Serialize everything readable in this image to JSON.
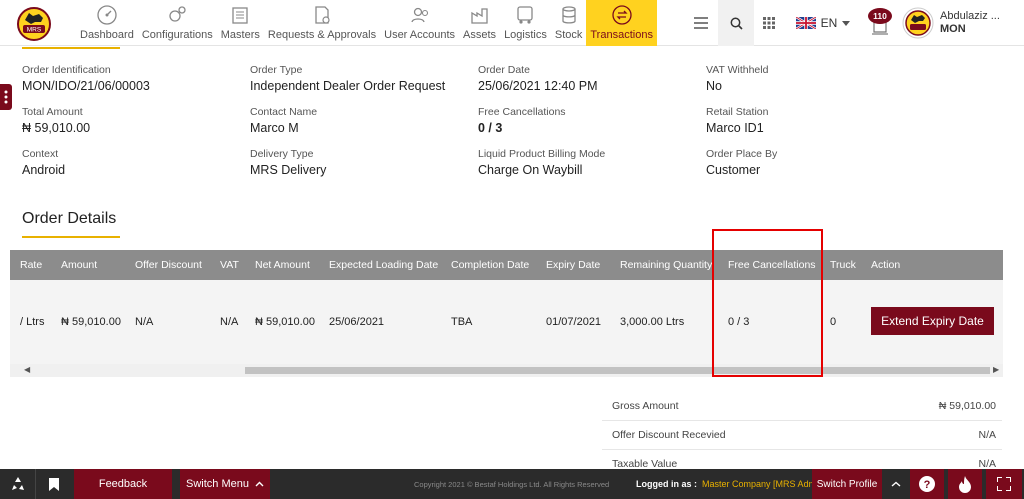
{
  "nav": {
    "items": [
      {
        "label": "Dashboard",
        "icon": "dashboard-icon"
      },
      {
        "label": "Configurations",
        "icon": "configurations-icon"
      },
      {
        "label": "Masters",
        "icon": "masters-icon"
      },
      {
        "label": "Requests & Approvals",
        "icon": "requests-icon"
      },
      {
        "label": "User Accounts",
        "icon": "user-accounts-icon"
      },
      {
        "label": "Assets",
        "icon": "assets-icon"
      },
      {
        "label": "Logistics",
        "icon": "logistics-icon"
      },
      {
        "label": "Stock",
        "icon": "stock-icon"
      },
      {
        "label": "Transactions",
        "icon": "transactions-icon",
        "active": true
      }
    ],
    "lang": "EN",
    "notifications": "110",
    "user_name": "Abdulaziz ...",
    "user_sub": "MON",
    "logo_text": "MRS"
  },
  "order": {
    "rows": [
      [
        {
          "label": "Order Identification",
          "value": "MON/IDO/21/06/00003"
        },
        {
          "label": "Order Type",
          "value": "Independent Dealer Order Request"
        },
        {
          "label": "Order Date",
          "value": "25/06/2021 12:40 PM"
        },
        {
          "label": "VAT Withheld",
          "value": "No"
        }
      ],
      [
        {
          "label": "Total Amount",
          "value": "₦ 59,010.00"
        },
        {
          "label": "Contact Name",
          "value": "Marco M"
        },
        {
          "label": "Free Cancellations",
          "value": "0 / 3"
        },
        {
          "label": "Retail Station",
          "value": "Marco ID1"
        }
      ],
      [
        {
          "label": "Context",
          "value": "Android"
        },
        {
          "label": "Delivery Type",
          "value": "MRS Delivery"
        },
        {
          "label": "Liquid Product Billing Mode",
          "value": "Charge On Waybill"
        },
        {
          "label": "Order Place By",
          "value": "Customer"
        }
      ]
    ]
  },
  "details": {
    "title": "Order Details",
    "headers": [
      "Rate",
      "Amount",
      "Offer Discount",
      "VAT",
      "Net Amount",
      "Expected Loading Date",
      "Completion Date",
      "Expiry Date",
      "Remaining Quantity",
      "Free Cancellations",
      "Truck",
      "Action"
    ],
    "row": [
      "/ Ltrs",
      "₦ 59,010.00",
      "N/A",
      "N/A",
      "₦ 59,010.00",
      "25/06/2021",
      "TBA",
      "01/07/2021",
      "3,000.00 Ltrs",
      "0 / 3",
      "0"
    ],
    "action_label": "Extend Expiry Date"
  },
  "totals": [
    {
      "label": "Gross Amount",
      "value": "₦ 59,010.00"
    },
    {
      "label": "Offer Discount Recevied",
      "value": "N/A"
    },
    {
      "label": "Taxable Value",
      "value": "N/A"
    }
  ],
  "footer": {
    "feedback": "Feedback",
    "switch_menu": "Switch Menu",
    "copyright": "Copyright 2021 © Bestaf Holdings Ltd. All Rights Reserved",
    "logged_label": "Logged in as :",
    "logged_value": "Master Company [MRS Admin]",
    "switch_profile": "Switch Profile"
  },
  "colors": {
    "brand": "#7a0a1c",
    "active": "#ffd21f",
    "highlight": "#e50000"
  }
}
